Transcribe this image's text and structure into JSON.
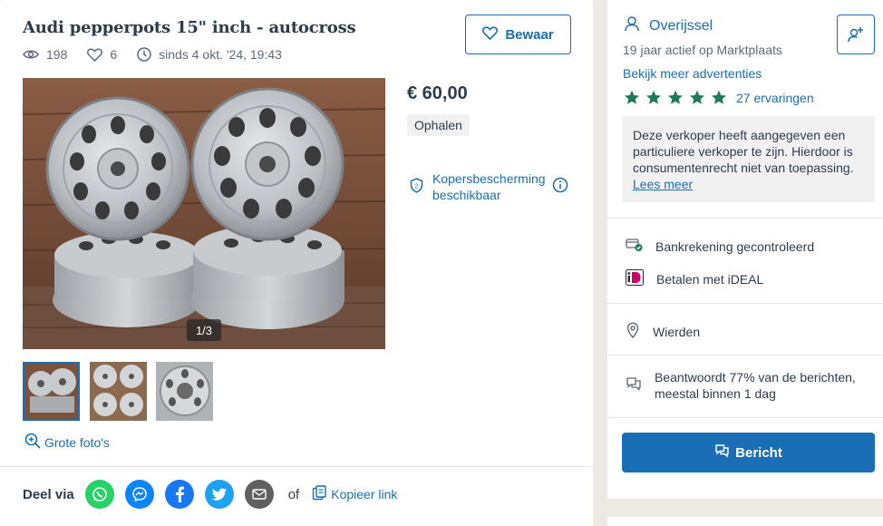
{
  "listing": {
    "title": "Audi pepperpots 15\" inch - autocross",
    "views": "198",
    "favorites": "6",
    "since": "sinds 4 okt. '24, 19:43",
    "save_label": "Bewaar",
    "photo_counter": "1/3",
    "large_photos_label": "Grote foto's",
    "price": "€ 60,00",
    "delivery": "Ophalen",
    "buyer_protection": "Kopersbescherming beschikbaar"
  },
  "share": {
    "label": "Deel via",
    "or": "of",
    "copy_link": "Kopieer link",
    "colors": {
      "whatsapp": "#25d366",
      "messenger": "#0a84ff",
      "facebook": "#1877f2",
      "twitter": "#1da1f2",
      "email": "#5f5f5f"
    }
  },
  "seller": {
    "region": "Overijssel",
    "active": "19 jaar actief op Marktplaats",
    "more_ads": "Bekijk meer advertenties",
    "rating": 5,
    "reviews": "27 ervaringen",
    "notice": "Deze verkoper heeft aangegeven een particuliere verkoper te zijn. Hierdoor is consumentenrecht niet van toepassing.",
    "notice_link": "Lees meer",
    "bank": "Bankrekening gecontroleerd",
    "ideal": "Betalen met iDEAL",
    "location": "Wierden",
    "response": "Beantwoordt 77% van de berichten, meestal binnen 1 dag",
    "message_button": "Bericht"
  },
  "colors": {
    "accent": "#1a6eb5",
    "star": "#1f7a5c",
    "text": "#2d3c4d"
  }
}
